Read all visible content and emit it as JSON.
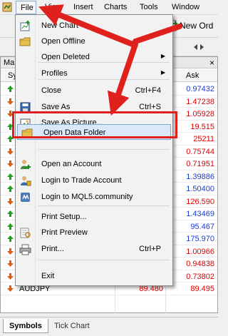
{
  "menubar": {
    "items": [
      "File",
      "View",
      "Insert",
      "Charts",
      "Tools",
      "Window"
    ]
  },
  "toolbar": {
    "new_order_label": "New Ord"
  },
  "market_watch": {
    "title": "Ma",
    "columns": {
      "symbol": "Sy",
      "ask": "Ask"
    },
    "rows": [
      {
        "direction": "up",
        "symbol": "",
        "bid": "",
        "ask": "0.97432",
        "ask_color": "blue"
      },
      {
        "direction": "down",
        "symbol": "",
        "bid": "",
        "ask": "1.47238",
        "ask_color": "red"
      },
      {
        "direction": "down",
        "symbol": "",
        "bid": "",
        "ask": "1.05928",
        "ask_color": "red"
      },
      {
        "direction": "up",
        "symbol": "",
        "bid": "",
        "ask": "19.515",
        "ask_color": "red"
      },
      {
        "direction": "up",
        "symbol": "",
        "bid": "",
        "ask": "25211",
        "ask_color": "red"
      },
      {
        "direction": "down",
        "symbol": "",
        "bid": "",
        "ask": "0.75744",
        "ask_color": "red"
      },
      {
        "direction": "down",
        "symbol": "",
        "bid": "",
        "ask": "0.71951",
        "ask_color": "red"
      },
      {
        "direction": "up",
        "symbol": "",
        "bid": "",
        "ask": "1.39886",
        "ask_color": "blue"
      },
      {
        "direction": "up",
        "symbol": "",
        "bid": "",
        "ask": "1.50400",
        "ask_color": "blue"
      },
      {
        "direction": "down",
        "symbol": "",
        "bid": "",
        "ask": "126.590",
        "ask_color": "red"
      },
      {
        "direction": "up",
        "symbol": "",
        "bid": "",
        "ask": "1.43469",
        "ask_color": "blue"
      },
      {
        "direction": "up",
        "symbol": "",
        "bid": "",
        "ask": "95.467",
        "ask_color": "blue"
      },
      {
        "direction": "up",
        "symbol": "",
        "bid": "",
        "ask": "175.970",
        "ask_color": "blue"
      },
      {
        "direction": "down",
        "symbol": "",
        "bid": "",
        "ask": "1.00966",
        "ask_color": "red"
      },
      {
        "direction": "down",
        "symbol": "AUDCAD",
        "bid": "0.94800",
        "ask": "0.94838",
        "ask_color": "red"
      },
      {
        "direction": "down",
        "symbol": "AUDCHF",
        "bid": "0.73765",
        "ask": "0.73802",
        "ask_color": "red"
      },
      {
        "direction": "down",
        "symbol": "AUDJPY",
        "bid": "89.480",
        "ask": "89.495",
        "ask_color": "red"
      }
    ]
  },
  "tabs": [
    {
      "label": "Symbols"
    },
    {
      "label": "Tick Chart"
    }
  ],
  "file_menu": {
    "items": [
      {
        "label": "New Chart",
        "shortcut": "",
        "submenu": false,
        "icon": "new-chart-icon"
      },
      {
        "label": "Open Offline",
        "shortcut": "",
        "submenu": false,
        "icon": "folder-icon"
      },
      {
        "label": "Open Deleted",
        "shortcut": "",
        "submenu": true,
        "icon": ""
      },
      {
        "label": "Profiles",
        "shortcut": "",
        "submenu": true,
        "icon": ""
      },
      {
        "label": "Close",
        "shortcut": "Ctrl+F4",
        "submenu": false,
        "icon": ""
      },
      {
        "label": "Save As",
        "shortcut": "Ctrl+S",
        "submenu": false,
        "icon": "save-icon"
      },
      {
        "label": "Save As Picture...",
        "shortcut": "",
        "submenu": false,
        "icon": "picture-icon"
      },
      {
        "label": "Open Data Folder",
        "shortcut": "",
        "submenu": false,
        "icon": "folder-icon",
        "highlighted": true
      },
      {
        "label": "Open an Account",
        "shortcut": "",
        "submenu": false,
        "icon": "add-account-icon"
      },
      {
        "label": "Login to Trade Account",
        "shortcut": "",
        "submenu": false,
        "icon": "login-icon"
      },
      {
        "label": "Login to MQL5.community",
        "shortcut": "",
        "submenu": false,
        "icon": "mql5-icon"
      },
      {
        "label": "Print Setup...",
        "shortcut": "",
        "submenu": false,
        "icon": ""
      },
      {
        "label": "Print Preview",
        "shortcut": "",
        "submenu": false,
        "icon": "print-preview-icon"
      },
      {
        "label": "Print...",
        "shortcut": "Ctrl+P",
        "submenu": false,
        "icon": "printer-icon"
      },
      {
        "label": "Exit",
        "shortcut": "",
        "submenu": false,
        "icon": ""
      }
    ]
  },
  "colors": {
    "annotation_red": "#e0201c",
    "bid_red": "#e00000",
    "ask_blue": "#1a3cd6",
    "menu_highlight": "#dbe8f8"
  }
}
